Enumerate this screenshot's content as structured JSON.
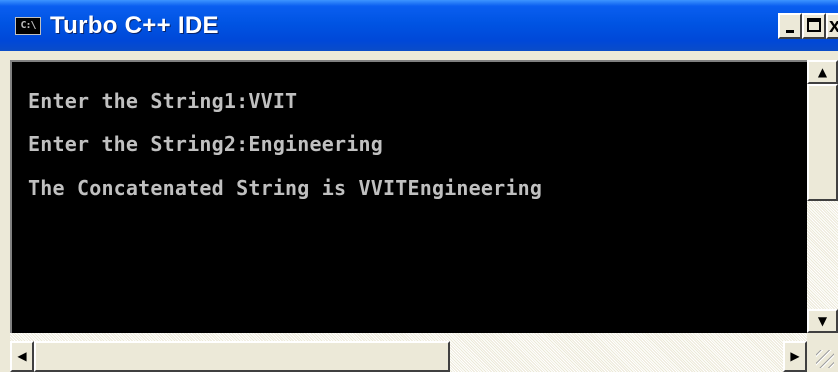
{
  "window": {
    "title": "Turbo C++ IDE",
    "system_icon_text": "C:\\",
    "minimize_symbol": "_",
    "maximize_symbol": "□",
    "close_symbol": "x"
  },
  "console": {
    "lines": [
      "Enter the String1:VVIT",
      "Enter the String2:Engineering",
      "The Concatenated String is VVITEngineering"
    ],
    "text_color": "#c0c0c0",
    "background_color": "#000000"
  },
  "scrollbars": {
    "up_arrow": "▲",
    "down_arrow": "▼",
    "left_arrow": "◀",
    "right_arrow": "▶"
  },
  "colors": {
    "titlebar": "#0054e3",
    "frame": "#ece9d8"
  }
}
